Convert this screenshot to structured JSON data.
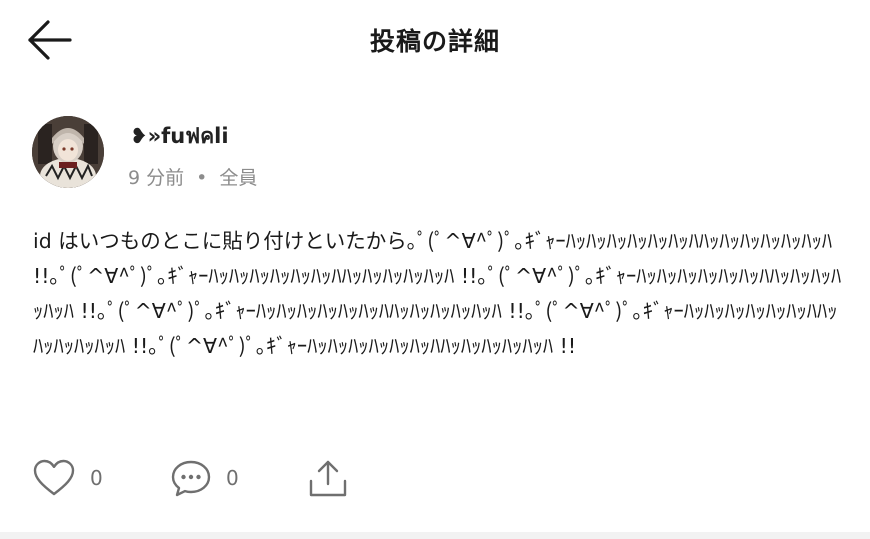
{
  "header": {
    "title": "投稿の詳細",
    "back_icon": "arrow-left-icon"
  },
  "post": {
    "author_name": "❥»fuฟคli",
    "time": "9 分前",
    "separator": "•",
    "visibility": "全員",
    "text": "id はいつものとこに貼り付けといたから｡ﾟ(ﾟ^∀^ﾟ)ﾟ｡ｷﾞｬｰﾊｯﾊｯﾊｯﾊｯﾊｯﾊｯﾊﾊｯﾊｯﾊｯﾊｯﾊｯﾊｯﾊ !!｡ﾟ(ﾟ^∀^ﾟ)ﾟ｡ｷﾞｬｰﾊｯﾊｯﾊｯﾊｯﾊｯﾊｯﾊﾊｯﾊｯﾊｯﾊｯﾊｯﾊ !!｡ﾟ(ﾟ^∀^ﾟ)ﾟ｡ｷﾞｬｰﾊｯﾊｯﾊｯﾊｯﾊｯﾊｯﾊﾊｯﾊｯﾊｯﾊｯﾊｯﾊ !!｡ﾟ(ﾟ^∀^ﾟ)ﾟ｡ｷﾞｬｰﾊｯﾊｯﾊｯﾊｯﾊｯﾊｯﾊﾊｯﾊｯﾊｯﾊｯﾊｯﾊ !!｡ﾟ(ﾟ^∀^ﾟ)ﾟ｡ｷﾞｬｰﾊｯﾊｯﾊｯﾊｯﾊｯﾊｯﾊﾊｯﾊｯﾊｯﾊｯﾊｯﾊ !!｡ﾟ(ﾟ^∀^ﾟ)ﾟ｡ｷﾞｬｰﾊｯﾊｯﾊｯﾊｯﾊｯﾊｯﾊﾊｯﾊｯﾊｯﾊｯﾊｯﾊ !!"
  },
  "actions": {
    "like_count": "0",
    "comment_count": "0",
    "like_icon": "heart-icon",
    "comment_icon": "comment-bubble-icon",
    "share_icon": "share-icon"
  },
  "colors": {
    "text": "#1a1a1a",
    "muted": "#8c8c8c",
    "icon": "#6f6f6f"
  }
}
